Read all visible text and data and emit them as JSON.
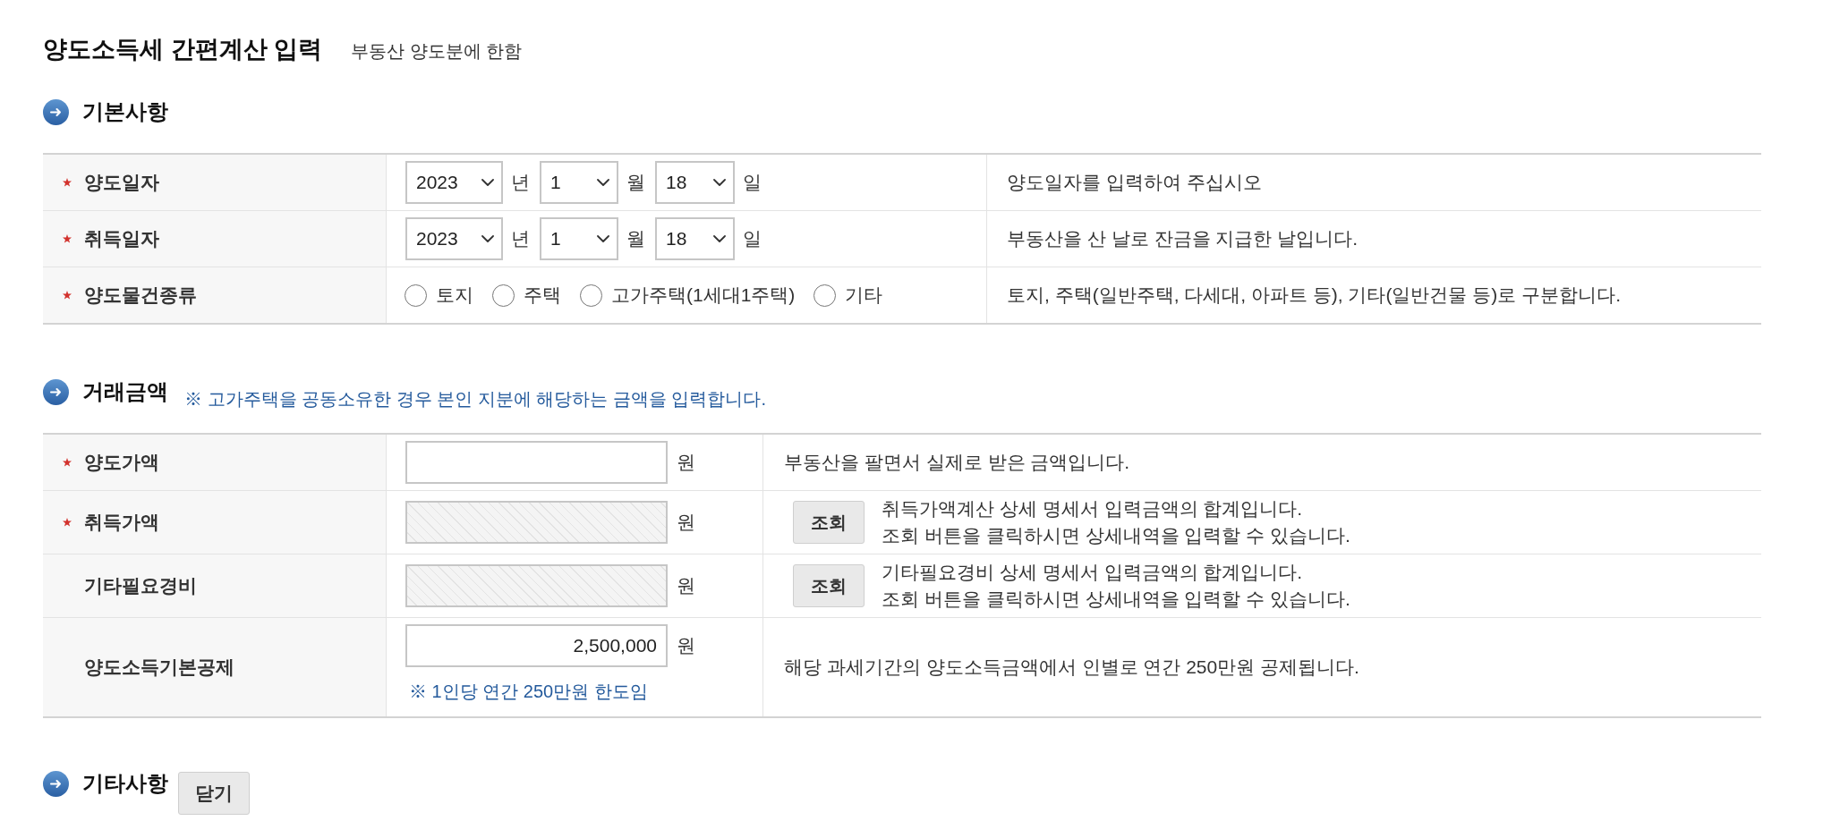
{
  "header": {
    "title": "양도소득세 간편계산 입력",
    "subtitle": "부동산 양도분에 한함"
  },
  "sections": [
    {
      "kind": "selection_table",
      "title": "기본사항",
      "rows": [
        {
          "kind": "date",
          "label": "양도일자",
          "required": true,
          "selects": [
            {
              "value": "2023",
              "unit": "년"
            },
            {
              "value": "1",
              "unit": "월"
            },
            {
              "value": "18",
              "unit": "일"
            }
          ],
          "description": [
            "양도일자를 입력하여 주십시오"
          ]
        },
        {
          "kind": "date",
          "label": "취득일자",
          "required": true,
          "selects": [
            {
              "value": "2023",
              "unit": "년"
            },
            {
              "value": "1",
              "unit": "월"
            },
            {
              "value": "18",
              "unit": "일"
            }
          ],
          "description": [
            "부동산을 산 날로 잔금을 지급한 날입니다."
          ]
        },
        {
          "kind": "radio",
          "label": "양도물건종류",
          "required": true,
          "options": [
            {
              "label": "토지",
              "selected": false
            },
            {
              "label": "주택",
              "selected": false
            },
            {
              "label": "고가주택(1세대1주택)",
              "selected": false
            },
            {
              "label": "기타",
              "selected": false
            }
          ],
          "description": [
            "토지, 주택(일반주택, 다세대, 아파트 등), 기타(일반건물 등)로 구분합니다."
          ]
        }
      ]
    },
    {
      "kind": "amount_table",
      "title": "거래금액",
      "note": "※ 고가주택을 공동소유한 경우 본인 지분에 해당하는 금액을 입력합니다.",
      "rows": [
        {
          "kind": "amount",
          "label": "양도가액",
          "required": true,
          "disabled": false,
          "unit": "원",
          "description": [
            "부동산을 팔면서 실제로 받은 금액입니다."
          ]
        },
        {
          "kind": "amount",
          "label": "취득가액",
          "required": true,
          "disabled": true,
          "unit": "원",
          "button": "조회",
          "description": [
            "취득가액계산 상세 명세서 입력금액의 합계입니다.",
            "조회 버튼을 클릭하시면 상세내역을 입력할 수 있습니다."
          ]
        },
        {
          "kind": "amount",
          "label": "기타필요경비",
          "required": false,
          "disabled": true,
          "unit": "원",
          "button": "조회",
          "description": [
            "기타필요경비 상세 명세서 입력금액의 합계입니다.",
            "조회 버튼을 클릭하시면 상세내역을 입력할 수 있습니다."
          ]
        },
        {
          "kind": "amount",
          "label": "양도소득기본공제",
          "required": false,
          "disabled": false,
          "value": "2,500,000",
          "unit": "원",
          "hint": "※ 1인당 연간 250만원 한도임",
          "description": [
            "해당 과세기간의 양도소득금액에서 인별로 연간 250만원 공제됩니다."
          ]
        }
      ]
    },
    {
      "kind": "collapsible",
      "title": "기타사항",
      "button": "닫기"
    }
  ]
}
